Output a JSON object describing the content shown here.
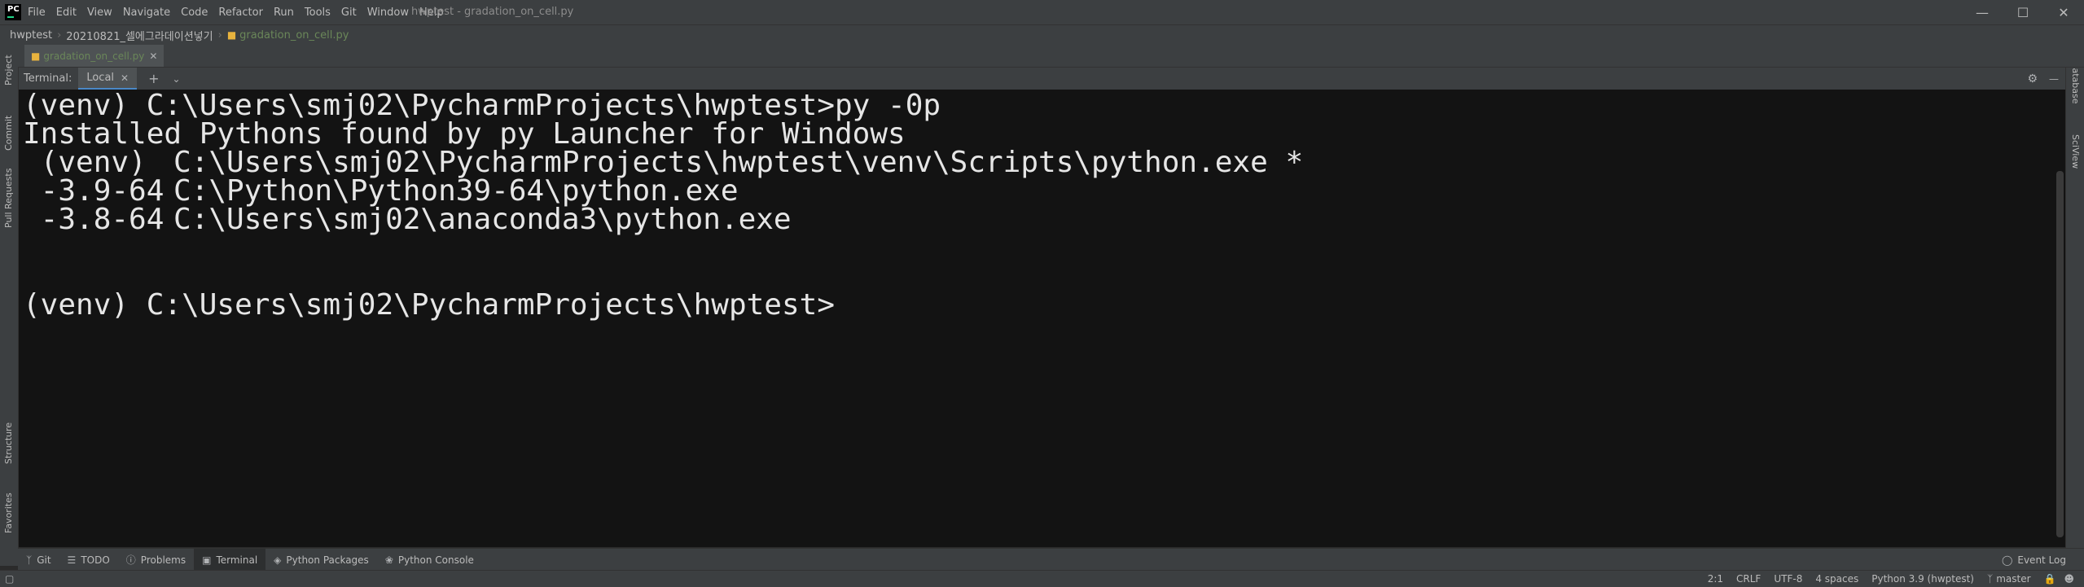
{
  "app": {
    "logo_text": "PC",
    "window_title": "hwptest - gradation_on_cell.py"
  },
  "menu": [
    {
      "label": "File"
    },
    {
      "label": "Edit"
    },
    {
      "label": "View"
    },
    {
      "label": "Navigate"
    },
    {
      "label": "Code"
    },
    {
      "label": "Refactor"
    },
    {
      "label": "Run"
    },
    {
      "label": "Tools"
    },
    {
      "label": "Git"
    },
    {
      "label": "Window"
    },
    {
      "label": "Help"
    }
  ],
  "breadcrumb": {
    "project": "hwptest",
    "folder": "20210821_셀에그라데이션넣기",
    "file": "gradation_on_cell.py"
  },
  "editor_tab": {
    "label": "gradation_on_cell.py"
  },
  "left_strip": [
    "Project",
    "Commit",
    "Pull Requests",
    "Structure",
    "Favorites"
  ],
  "right_strip": [
    "Database",
    "SciView"
  ],
  "terminal": {
    "header_label": "Terminal:",
    "tab_label": "Local",
    "lines": {
      "l1": "(venv) C:\\Users\\smj02\\PycharmProjects\\hwptest>py -0p",
      "l2": "Installed Pythons found by py Launcher for Windows",
      "l3a": " (venv)",
      "l3b": "C:\\Users\\smj02\\PycharmProjects\\hwptest\\venv\\Scripts\\python.exe *",
      "l4a": " -3.9-64",
      "l4b": "C:\\Python\\Python39-64\\python.exe",
      "l5a": " -3.8-64",
      "l5b": "C:\\Users\\smj02\\anaconda3\\python.exe",
      "l6": "(venv) C:\\Users\\smj02\\PycharmProjects\\hwptest>"
    }
  },
  "bottom_tools": [
    {
      "label": "Git",
      "icon": "git-branch-icon"
    },
    {
      "label": "TODO",
      "icon": "list-icon"
    },
    {
      "label": "Problems",
      "icon": "info-icon"
    },
    {
      "label": "Terminal",
      "icon": "terminal-icon"
    },
    {
      "label": "Python Packages",
      "icon": "packages-icon"
    },
    {
      "label": "Python Console",
      "icon": "python-icon"
    }
  ],
  "event_log": "Event Log",
  "status": {
    "position": "2:1",
    "line_sep": "CRLF",
    "encoding": "UTF-8",
    "indent": "4 spaces",
    "interpreter": "Python 3.9 (hwptest)",
    "branch": "master"
  }
}
